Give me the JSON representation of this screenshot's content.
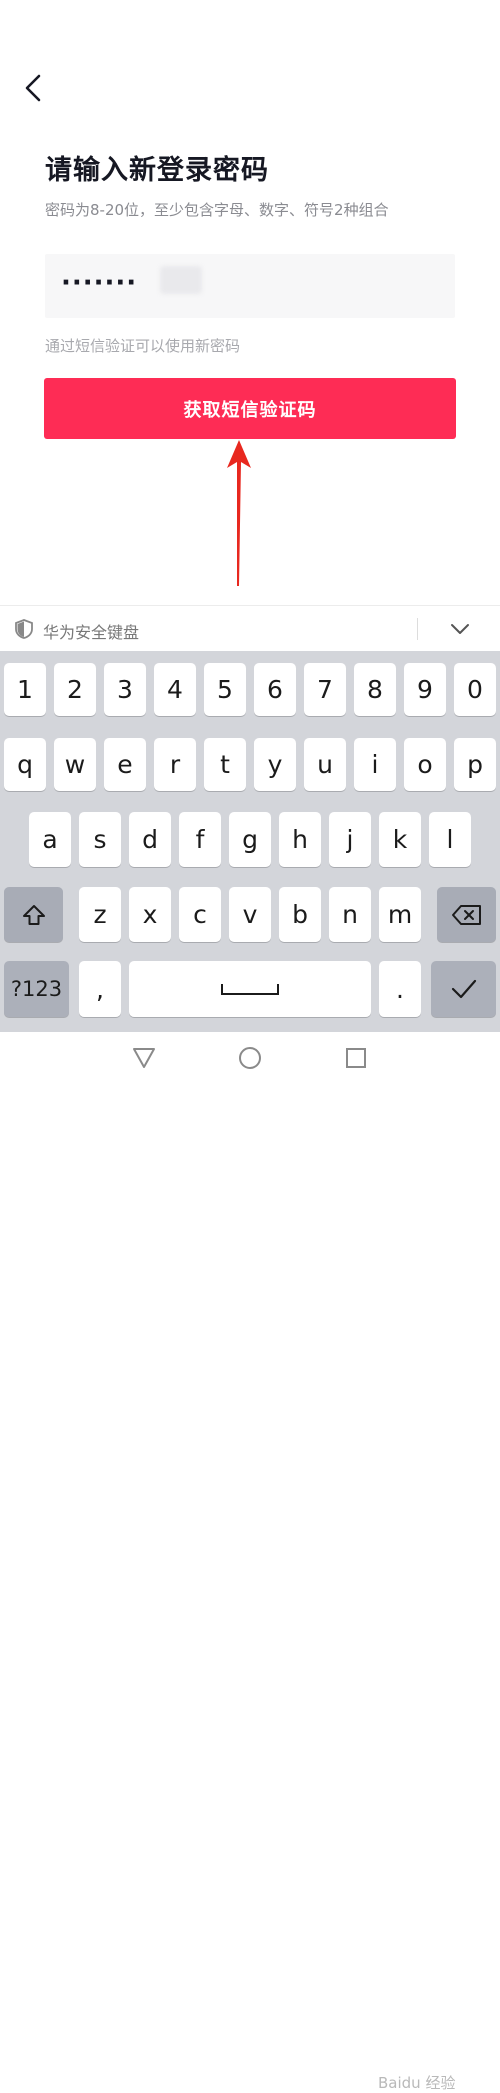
{
  "header": {
    "back_icon": "chevron-left-icon"
  },
  "form": {
    "title": "请输入新登录密码",
    "subtitle": "密码为8-20位，至少包含字母、数字、符号2种组合",
    "password_masked": "·······",
    "hint": "通过短信验证可以使用新密码",
    "sms_button_label": "获取短信验证码"
  },
  "keyboard": {
    "title": "华为安全键盘",
    "shield_icon": "shield-icon",
    "collapse_icon": "chevron-down-icon",
    "row_numbers": [
      "1",
      "2",
      "3",
      "4",
      "5",
      "6",
      "7",
      "8",
      "9",
      "0"
    ],
    "row_1": [
      "q",
      "w",
      "e",
      "r",
      "t",
      "y",
      "u",
      "i",
      "o",
      "p"
    ],
    "row_2": [
      "a",
      "s",
      "d",
      "f",
      "g",
      "h",
      "j",
      "k",
      "l"
    ],
    "row_3": [
      "z",
      "x",
      "c",
      "v",
      "b",
      "n",
      "m"
    ],
    "shift_icon": "shift-icon",
    "backspace_icon": "backspace-icon",
    "symbols_label": "?123",
    "comma_label": ",",
    "space_icon": "space-icon",
    "period_label": ".",
    "enter_icon": "checkmark-icon"
  },
  "navbar": {
    "back_icon": "triangle-back-icon",
    "home_icon": "circle-home-icon",
    "recents_icon": "square-recents-icon"
  },
  "watermark": "Baidu 经验",
  "colors": {
    "accent": "#fe2c55",
    "arrow": "#e8281f",
    "keyboard_bg": "#d3d5da"
  }
}
